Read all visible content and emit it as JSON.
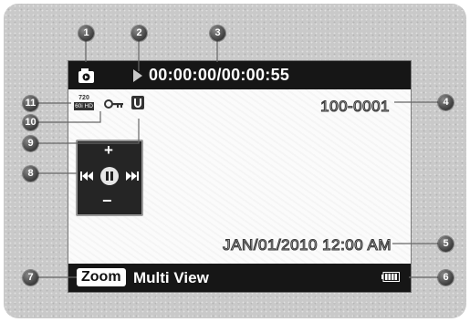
{
  "osd": {
    "timecode": "00:00:00/00:00:55",
    "file_number": "100-0001",
    "datetime": "JAN/01/2010 12:00 AM",
    "zoom_label": "Zoom",
    "multiview_label": "Multi View",
    "quality_top": "720",
    "quality_bottom": "60i HD",
    "icons": {
      "mode": "playback-mode-icon",
      "play": "play-icon",
      "quality": "video-quality-icon",
      "protect": "protect-key-icon",
      "storage": "storage-media-icon",
      "battery": "battery-icon"
    },
    "controls": {
      "plus": "+",
      "minus": "−",
      "rewind": "rewind-icon",
      "pause": "play-pause-icon",
      "fast_forward": "fast-forward-icon"
    }
  },
  "callouts": [
    "1",
    "2",
    "3",
    "4",
    "5",
    "6",
    "7",
    "8",
    "9",
    "10",
    "11"
  ],
  "colors": {
    "bar_background": "#161616",
    "screen_background": "#fbfbfb",
    "frame_background": "#c9c9c9",
    "callout_badge": "#4a4a4a"
  }
}
